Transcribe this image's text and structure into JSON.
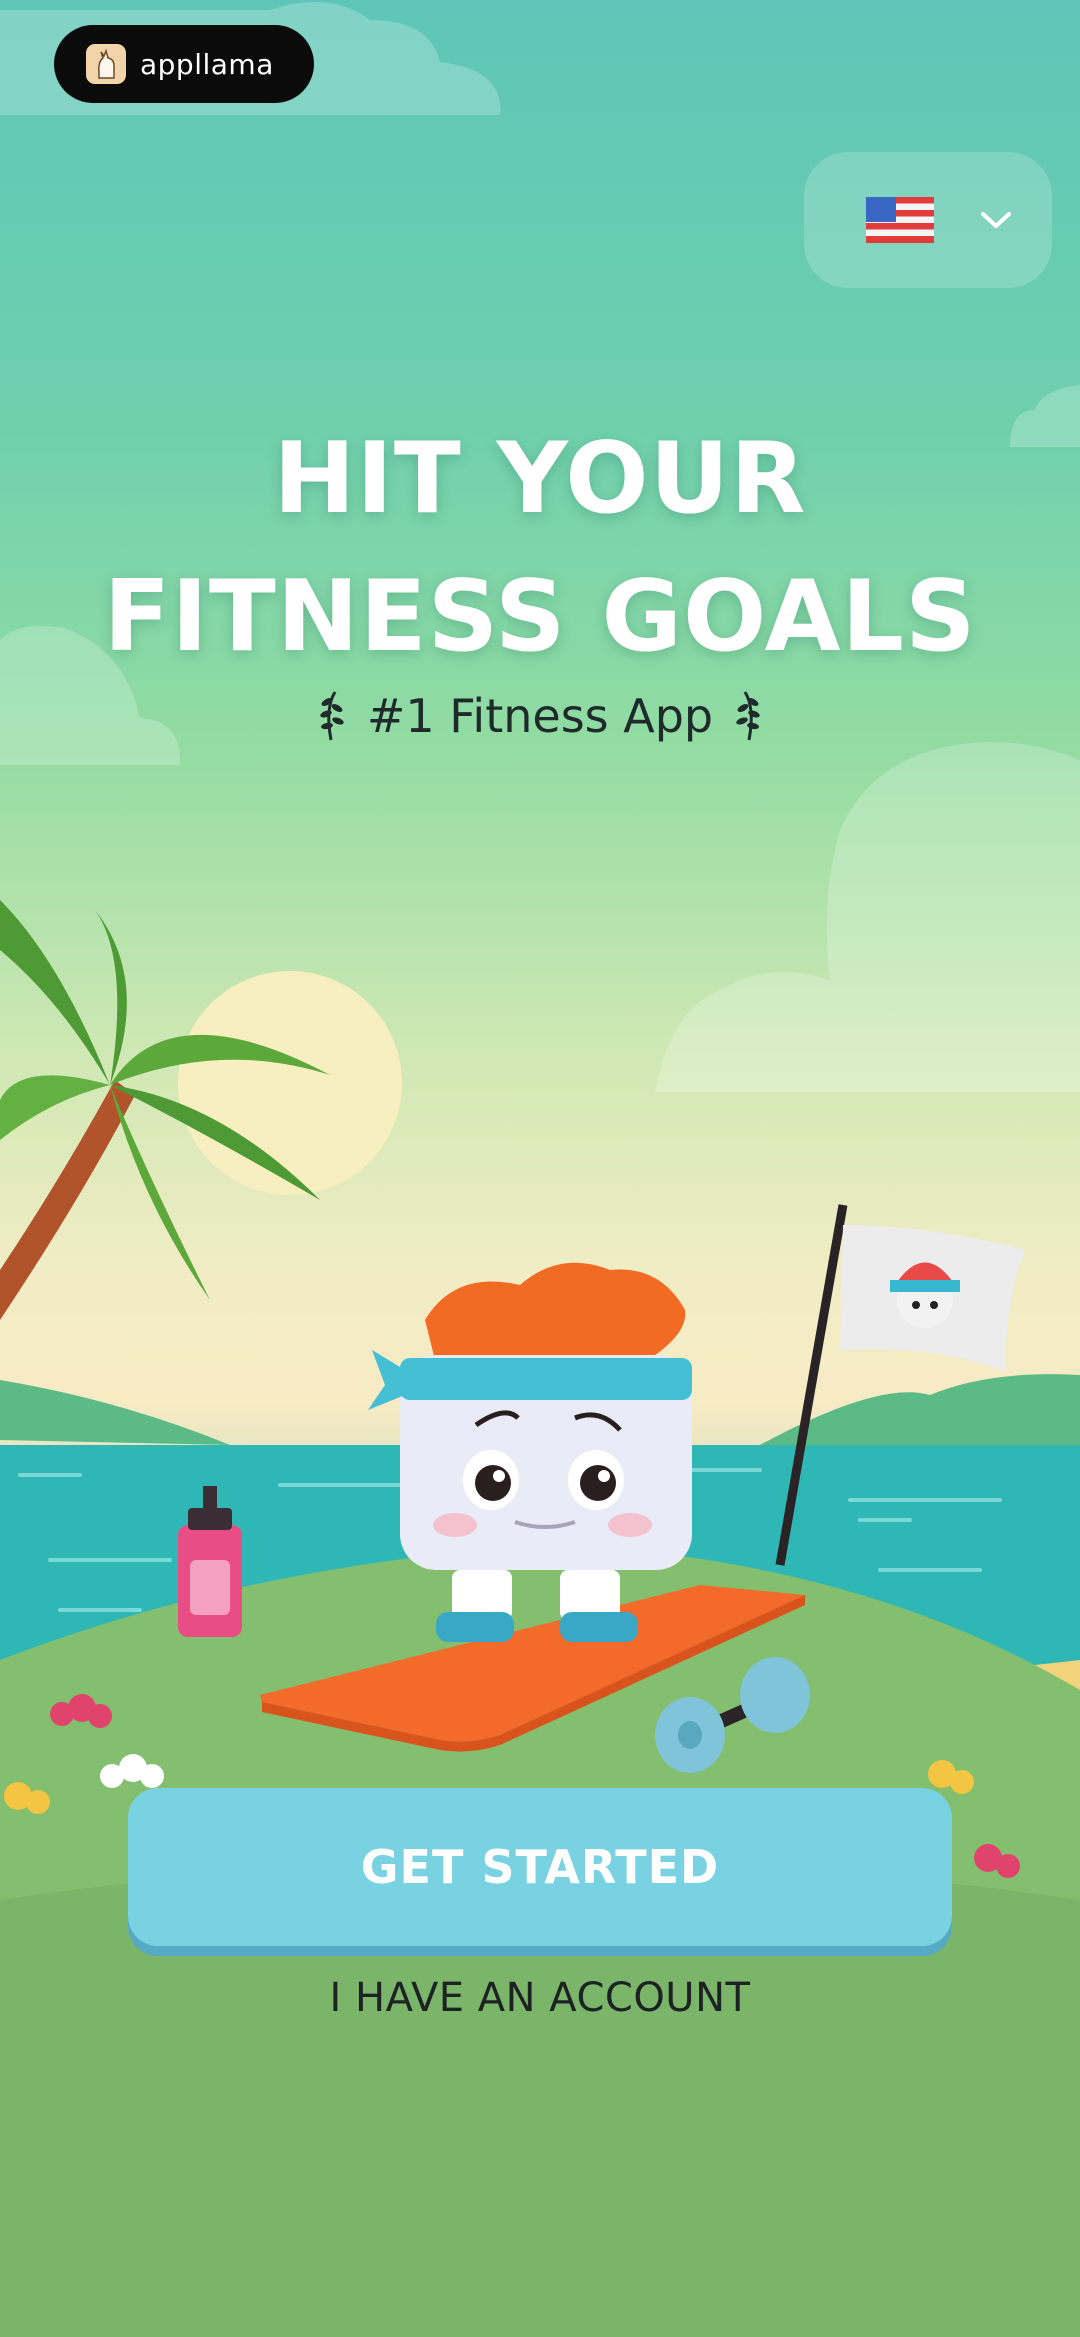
{
  "brand_badge": {
    "name": "appllama"
  },
  "language_selector": {
    "flag_icon": "us-flag-icon",
    "chevron_icon": "chevron-down-icon"
  },
  "headline": {
    "line1": "HIT YOUR",
    "line2": "FITNESS GOALS"
  },
  "subtitle": {
    "text": "#1 Fitness App",
    "decoration_icon": "laurel-icon"
  },
  "buttons": {
    "get_started": "GET STARTED",
    "have_account": "I HAVE AN ACCOUNT"
  },
  "colors": {
    "sky_top": "#5ec6b8",
    "button": "#78d2e2",
    "button_shadow": "#56aac6",
    "sea": "#2fb7b5",
    "grass": "#7fb86f"
  }
}
